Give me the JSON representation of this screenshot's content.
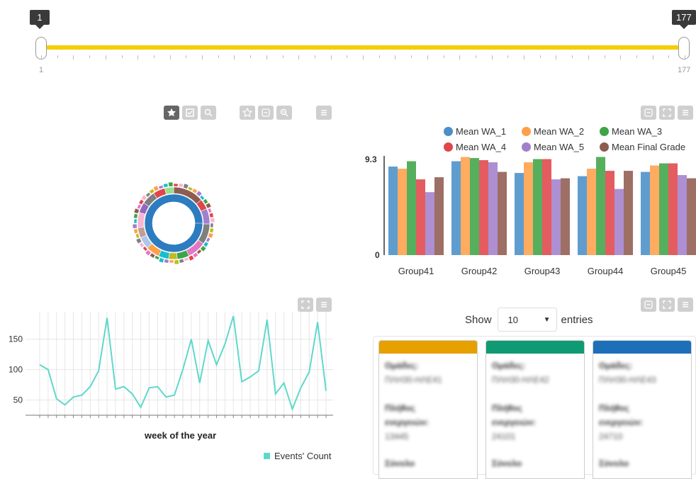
{
  "slider": {
    "min_label": "1",
    "max_label": "177",
    "tip_left": "1",
    "tip_right": "177",
    "low": 1,
    "high": 177,
    "color": "#f5cd00"
  },
  "sunburst_toolbar": {
    "icons": [
      "star-icon",
      "check-icon",
      "search-icon",
      "star-outline-icon",
      "minus-box-icon",
      "zoom-out-icon",
      "menu-icon"
    ]
  },
  "bar_chart": {
    "legend": [
      {
        "name": "Mean WA_1",
        "color": "#4a8fc8"
      },
      {
        "name": "Mean WA_2",
        "color": "#ff9f4a"
      },
      {
        "name": "Mean WA_3",
        "color": "#3fa447"
      },
      {
        "name": "Mean WA_4",
        "color": "#e0454a"
      },
      {
        "name": "Mean WA_5",
        "color": "#a27fcc"
      },
      {
        "name": "Mean Final Grade",
        "color": "#8f5b50"
      }
    ],
    "y_max_label": "9.3",
    "y_min_label": "0",
    "toolbar": [
      "minus-box-icon",
      "fullscreen-icon",
      "menu-icon"
    ]
  },
  "chart_data": [
    {
      "type": "bar",
      "categories": [
        "Group41",
        "Group42",
        "Group43",
        "Group44",
        "Group45"
      ],
      "ylim": [
        0,
        9.3
      ],
      "series": [
        {
          "name": "Mean WA_1",
          "values": [
            8.3,
            8.8,
            7.7,
            7.4,
            7.8
          ]
        },
        {
          "name": "Mean WA_2",
          "values": [
            8.1,
            9.2,
            8.7,
            8.1,
            8.4
          ]
        },
        {
          "name": "Mean WA_3",
          "values": [
            8.8,
            9.1,
            9.0,
            9.2,
            8.6
          ]
        },
        {
          "name": "Mean WA_4",
          "values": [
            7.1,
            8.9,
            9.0,
            7.9,
            8.6
          ]
        },
        {
          "name": "Mean WA_5",
          "values": [
            5.9,
            8.7,
            7.1,
            6.2,
            7.5
          ]
        },
        {
          "name": "Mean Final Grade",
          "values": [
            7.3,
            7.8,
            7.2,
            7.9,
            7.2
          ]
        }
      ]
    },
    {
      "type": "line",
      "xlabel": "week of the year",
      "yticks": [
        50,
        100,
        150
      ],
      "ylim": [
        25,
        195
      ],
      "series": [
        {
          "name": "Events' Count",
          "color": "#5fd8cc",
          "values": [
            108,
            100,
            52,
            42,
            55,
            58,
            72,
            98,
            185,
            68,
            72,
            60,
            38,
            70,
            72,
            55,
            58,
            100,
            150,
            78,
            148,
            108,
            142,
            188,
            80,
            88,
            98,
            182,
            60,
            78,
            35,
            70,
            96,
            178,
            65
          ]
        }
      ]
    }
  ],
  "line_chart": {
    "xlabel": "week of the year",
    "legend_label": "Events' Count",
    "legend_color": "#5fd8cc",
    "yticks": [
      "150",
      "100",
      "50"
    ],
    "toolbar": [
      "fullscreen-icon",
      "menu-icon"
    ]
  },
  "table": {
    "show_label": "Show",
    "entries_value": "10",
    "entries_label": "entries",
    "toolbar": [
      "minus-box-icon",
      "fullscreen-icon",
      "menu-icon"
    ],
    "cards": [
      {
        "color": "#e6a000",
        "l1": "Ομάδες:",
        "l2": "ΠΛΗ30-ΗΛΕ41",
        "l3": "Πλήθος",
        "l4": "ενεργειών:",
        "l5": "13445",
        "l6": "Σύνολο"
      },
      {
        "color": "#109a73",
        "l1": "Ομάδες:",
        "l2": "ΠΛΗ30-ΗΛΕ42",
        "l3": "Πλήθος",
        "l4": "ενεργειών:",
        "l5": "24101",
        "l6": "Σύνολο"
      },
      {
        "color": "#1d6fb8",
        "l1": "Ομάδες:",
        "l2": "ΠΛΗ30-ΗΛΕ43",
        "l3": "Πλήθος",
        "l4": "ενεργειών:",
        "l5": "24710",
        "l6": "Σύνολο"
      }
    ]
  }
}
